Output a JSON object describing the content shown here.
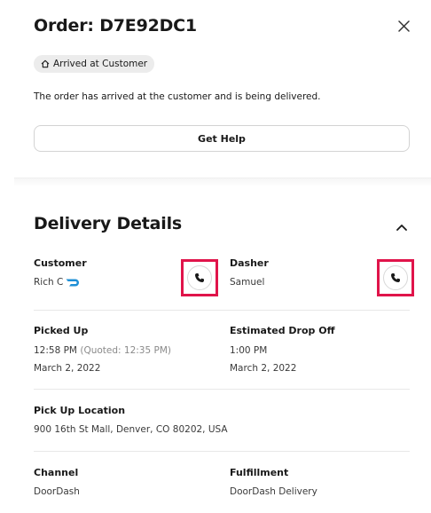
{
  "order": {
    "title": "Order: D7E92DC1",
    "status_badge": "Arrived at Customer",
    "description": "The order has arrived at the customer and is being delivered.",
    "help_label": "Get Help"
  },
  "delivery": {
    "title": "Delivery Details",
    "customer": {
      "label": "Customer",
      "name": "Rich C"
    },
    "dasher": {
      "label": "Dasher",
      "name": "Samuel"
    },
    "picked_up": {
      "label": "Picked Up",
      "time": "12:58 PM",
      "quoted": "(Quoted: 12:35 PM)",
      "date": "March 2, 2022"
    },
    "estimated_drop_off": {
      "label": "Estimated Drop Off",
      "time": "1:00 PM",
      "date": "March 2, 2022"
    },
    "pickup_location": {
      "label": "Pick Up Location",
      "address": "900 16th St Mall, Denver, CO 80202, USA"
    },
    "channel": {
      "label": "Channel",
      "value": "DoorDash"
    },
    "fulfillment": {
      "label": "Fulfillment",
      "value": "DoorDash Delivery"
    }
  },
  "icons": {
    "close": "close-icon",
    "badge": "home-icon",
    "collapse": "chevron-up-icon",
    "phone": "phone-icon",
    "brand": "doordash-logo"
  },
  "colors": {
    "highlight": "#e0144a",
    "brand": "#1e8fd6",
    "divider": "#e8e8e8"
  }
}
